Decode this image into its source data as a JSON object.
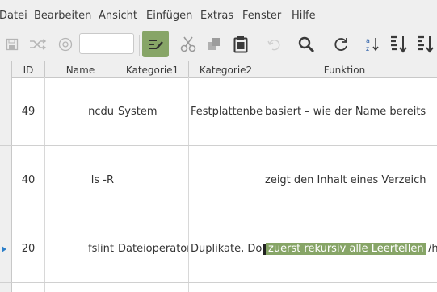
{
  "menu": [
    "Datei",
    "Bearbeiten",
    "Ansicht",
    "Einfügen",
    "Extras",
    "Fenster",
    "Hilfe"
  ],
  "toolbar": {
    "search_value": "",
    "icons": [
      "save-icon",
      "shuffle-icon",
      "clock-icon",
      "edit-icon",
      "cut-icon",
      "copy-icon",
      "paste-icon",
      "undo-icon",
      "find-icon",
      "refresh-icon",
      "sort-az-icon",
      "sort-ascending-icon",
      "sort-descending-icon"
    ]
  },
  "grid": {
    "columns": [
      "ID",
      "Name",
      "Kategorie1",
      "Kategorie2",
      "Funktion"
    ],
    "rows": [
      {
        "id": "49",
        "name": "ncdu",
        "kat1": "System",
        "kat2": "Festplattenbele",
        "funktion": "basiert – wie der Name bereits ver",
        "extra": ""
      },
      {
        "id": "40",
        "name": "ls -R",
        "kat1": "",
        "kat2": "",
        "funktion": "zeigt den Inhalt eines Verzeichnisse",
        "extra": ""
      },
      {
        "id": "20",
        "name": "fslint",
        "kat1": "Dateioperator",
        "kat2": "Duplikate, Doul",
        "funktion": "zuerst rekursiv alle Leertellen aus",
        "extra": "/h"
      }
    ],
    "selected_row": 2,
    "colors": {
      "selection": "#87a567",
      "row_indicator": "#2c7fc9"
    }
  }
}
